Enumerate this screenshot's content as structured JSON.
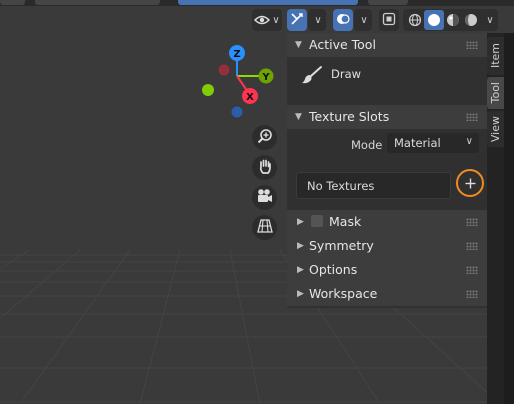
{
  "colors": {
    "accent_blue": "#4772b3",
    "axis_x": "#ff3352",
    "axis_y": "#8bdc00",
    "axis_z": "#2890ff",
    "highlight_circle": "#f08a24"
  },
  "viewport": {
    "gizmo": {
      "x_label": "X",
      "y_label": "Y",
      "z_label": "Z"
    }
  },
  "header": {
    "icons": [
      "visibility-icon",
      "gizmo-toggle-icon",
      "overlay-icon",
      "xray-icon",
      "wireframe-shading-icon",
      "solid-shading-icon",
      "material-shading-icon",
      "rendered-shading-icon"
    ]
  },
  "nav_buttons": [
    "zoom-icon",
    "hand-pan-icon",
    "camera-icon",
    "perspective-grid-icon"
  ],
  "sidebar": {
    "active_tool": {
      "title": "Active Tool",
      "tool_name": "Draw",
      "icon": "brush-icon"
    },
    "texture_slots": {
      "title": "Texture Slots",
      "mode_label": "Mode",
      "mode_value": "Material",
      "textures_text": "No Textures",
      "add_icon": "plus-icon"
    },
    "sections": [
      {
        "title": "Mask",
        "has_checkbox": true
      },
      {
        "title": "Symmetry"
      },
      {
        "title": "Options"
      },
      {
        "title": "Workspace"
      }
    ]
  },
  "tabs": [
    {
      "label": "Item",
      "active": false
    },
    {
      "label": "Tool",
      "active": true
    },
    {
      "label": "View",
      "active": false
    }
  ]
}
